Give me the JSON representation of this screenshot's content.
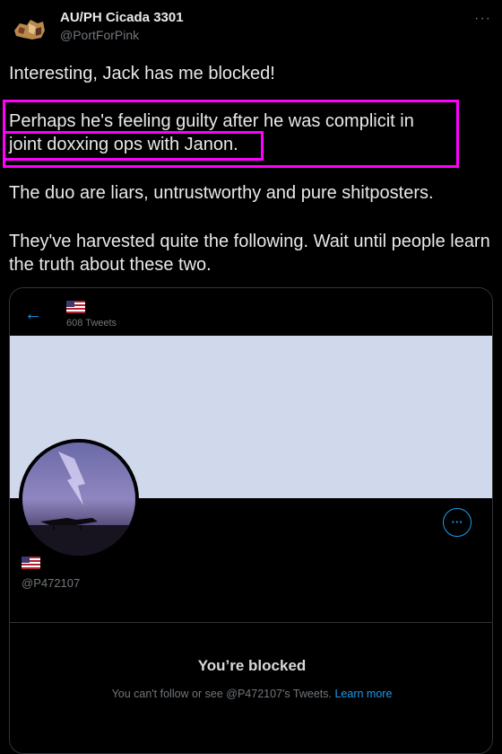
{
  "tweet": {
    "author_name": "AU/PH Cicada 3301",
    "author_handle": "@PortForPink",
    "more_icon": "more-horizontal-icon",
    "paragraphs": {
      "p1": "Interesting, Jack has me blocked!",
      "p2_line1": "Perhaps he's feeling guilty after he was complicit in",
      "p2_line2": "joint doxxing ops with Janon.",
      "p3": "The duo are liars, untrustworthy and pure shitposters.",
      "p4": "They've harvested quite the following. Wait until people learn the truth about these two."
    },
    "highlight_color": "#ff00ff"
  },
  "embedded_profile": {
    "back_icon": "back-arrow-icon",
    "tweet_count": "608 Tweets",
    "flag_icon": "us-flag-icon",
    "handle": "@P472107",
    "more_icon": "more-horizontal-icon",
    "banner_color": "#d0d8ec",
    "blocked_title": "You’re blocked",
    "blocked_message": "You can't follow or see @P472107's Tweets.",
    "learn_more": "Learn more",
    "accent": "#1d9bf0"
  }
}
